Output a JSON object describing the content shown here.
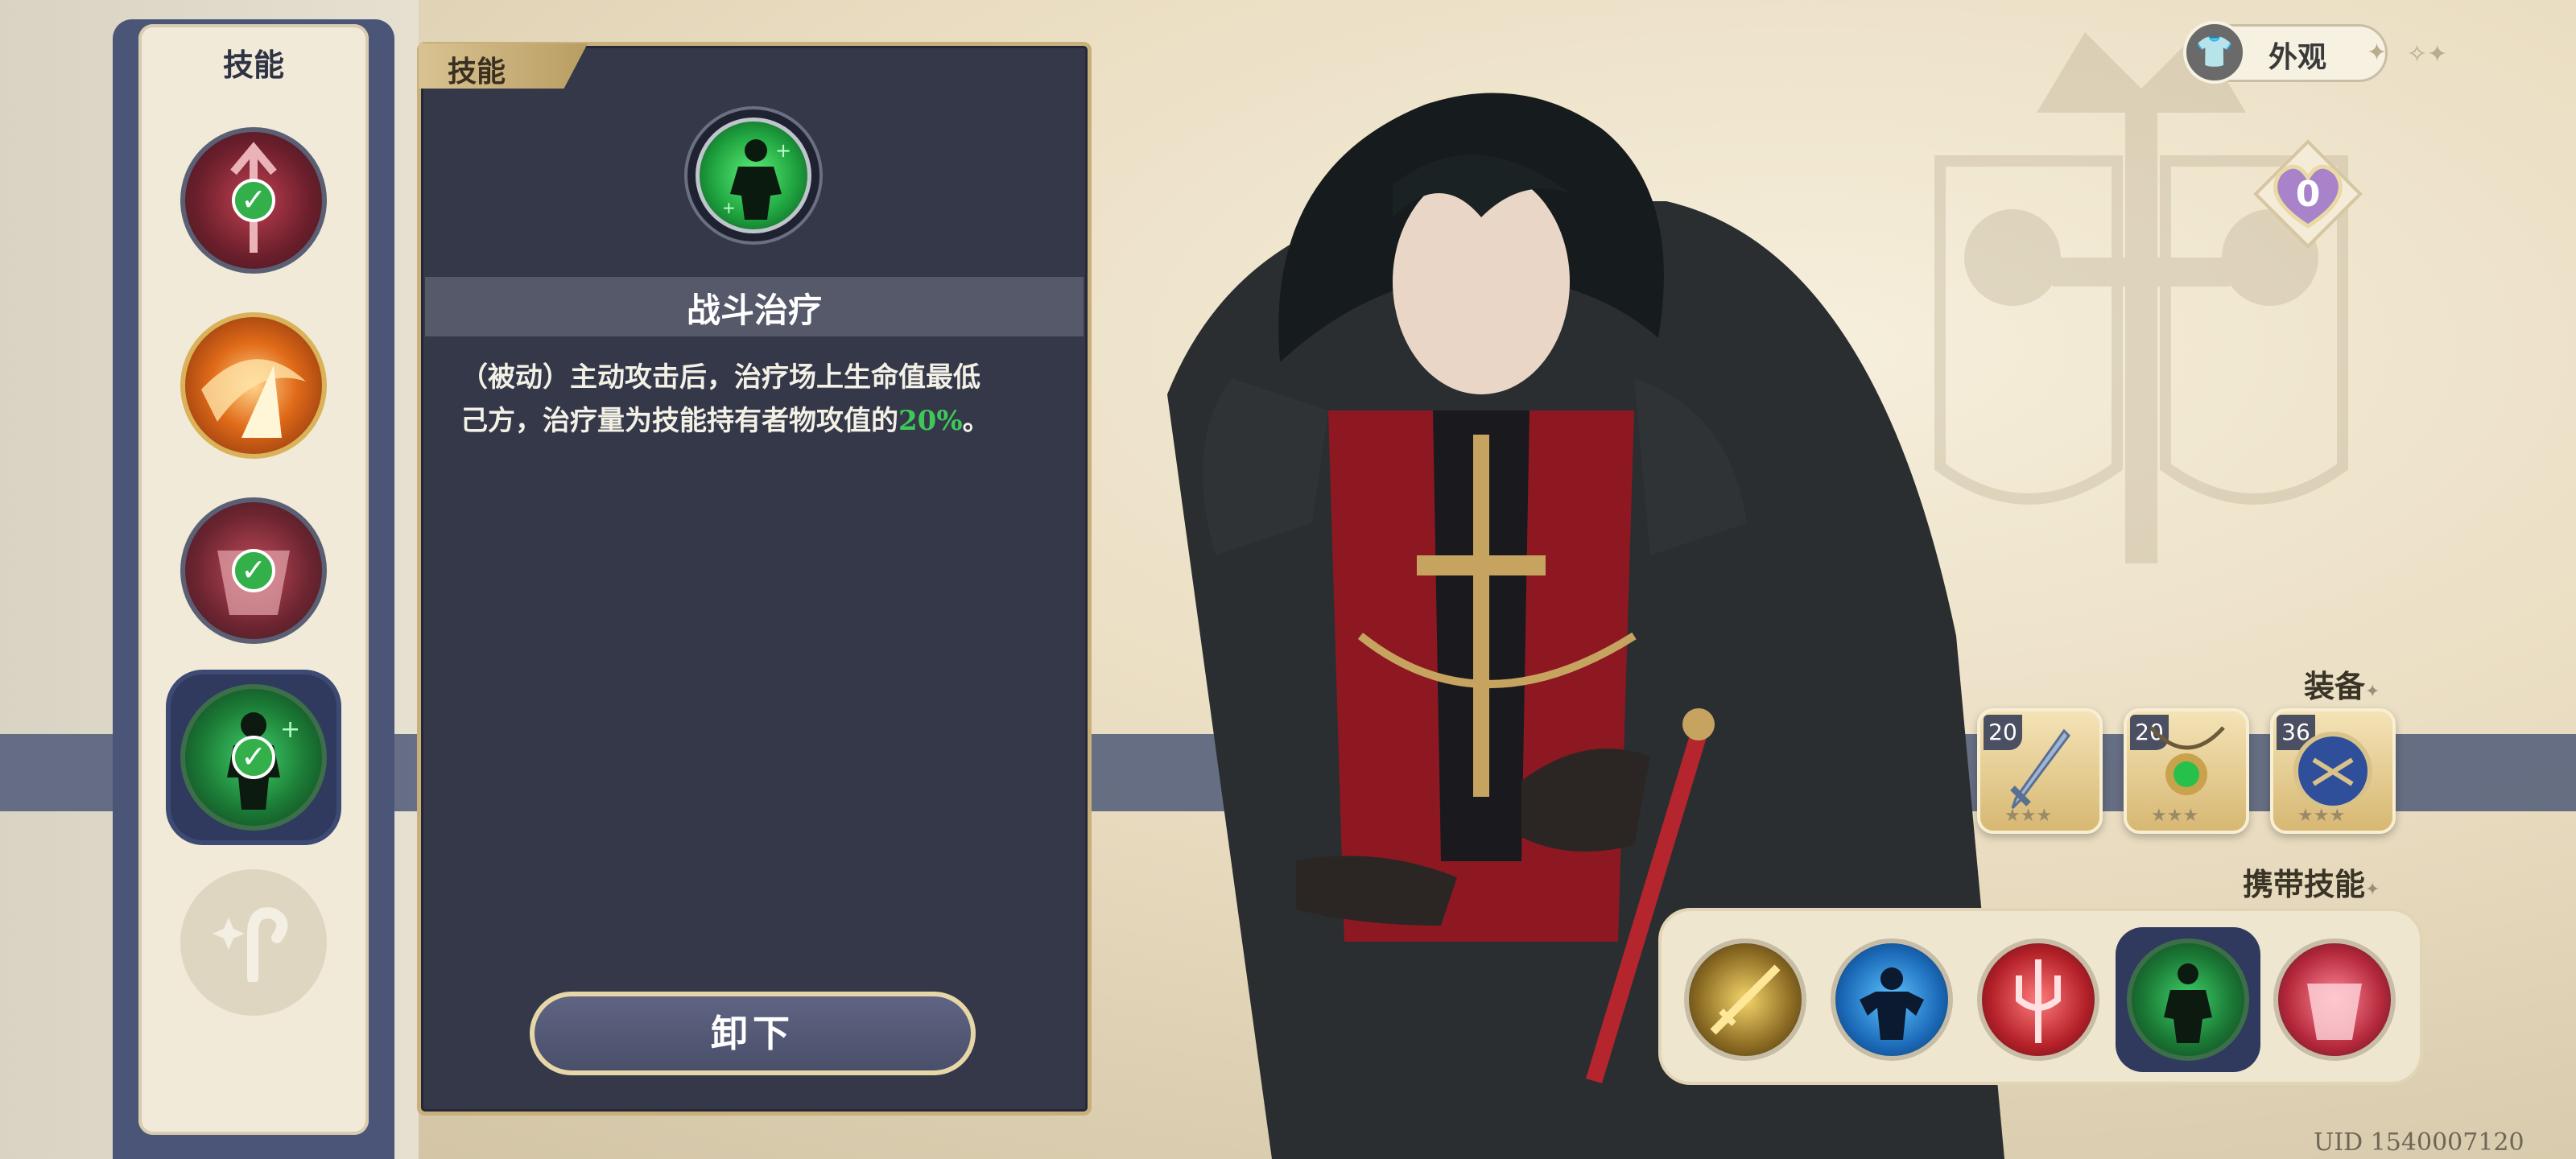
{
  "skill_strip": {
    "title": "技能",
    "slots": [
      {
        "name": "crimson-spear-skill",
        "equipped": true
      },
      {
        "name": "golden-burst-skill",
        "equipped": false
      },
      {
        "name": "crimson-armor-skill",
        "equipped": true
      },
      {
        "name": "battle-heal-skill",
        "equipped": true,
        "selected": true
      },
      {
        "name": "empty-slot",
        "equipped": false
      }
    ]
  },
  "detail_panel": {
    "tab_label": "技能",
    "skill_name": "战斗治疗",
    "desc_line1": "（被动）主动攻击后，治疗场上生命值最低",
    "desc_line2_prefix": "己方，治疗量为技能持有者物攻值的",
    "desc_pct": "20%",
    "desc_suffix": "。",
    "unequip_label": "卸下"
  },
  "top_right": {
    "appearance_label": "外观",
    "badge_count": "0"
  },
  "equipment": {
    "title": "装备",
    "items": [
      {
        "level": "20",
        "icon": "sword-icon"
      },
      {
        "level": "20",
        "icon": "green-amulet-icon"
      },
      {
        "level": "36",
        "icon": "blue-emblem-icon"
      }
    ]
  },
  "carried_skills": {
    "title": "携带技能",
    "items": [
      {
        "icon": "golden-sword-icon"
      },
      {
        "icon": "blue-strength-icon"
      },
      {
        "icon": "red-trident-icon"
      },
      {
        "icon": "green-heal-icon",
        "selected": true
      },
      {
        "icon": "red-armor-icon"
      }
    ]
  },
  "uid": "UID 1540007120",
  "colors": {
    "panel_bg": "#343848",
    "accent_gold": "#c9b07a",
    "heal_green": "#3ec85a",
    "strip_navy": "#4a5577"
  }
}
